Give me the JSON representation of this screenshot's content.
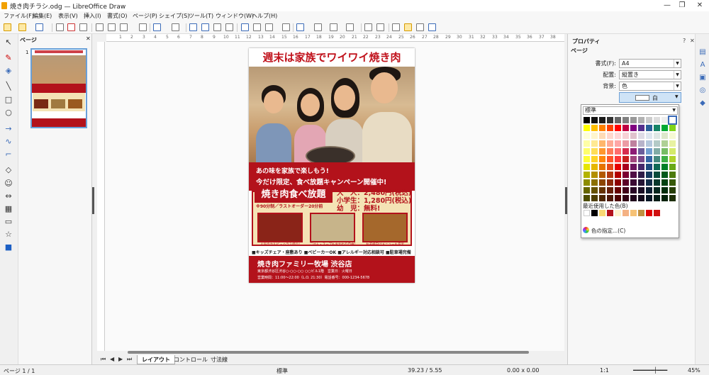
{
  "window": {
    "title": "焼き肉チラシ.odg — LibreOffice Draw",
    "controls": [
      "—",
      "❐",
      "✕"
    ]
  },
  "menu": [
    "ファイル(F)",
    "編集(E)",
    "表示(V)",
    "挿入(I)",
    "書式(O)",
    "ページ(P)",
    "シェイプ(S)",
    "ツール(T)",
    "ウィンドウ(W)",
    "ヘルプ(H)"
  ],
  "pages_panel": {
    "title": "ページ",
    "close": "✕",
    "page_number": "1"
  },
  "ruler_h": [
    "1",
    "2",
    "3",
    "4",
    "5",
    "6",
    "7",
    "8",
    "9",
    "10",
    "11",
    "12",
    "13",
    "14",
    "15",
    "16",
    "17",
    "18",
    "19",
    "20",
    "21",
    "22",
    "23",
    "24",
    "25",
    "26",
    "27",
    "28",
    "29",
    "30",
    "31",
    "32",
    "33",
    "34",
    "35",
    "36",
    "37",
    "38"
  ],
  "flyer": {
    "title": "週末は家族でワイワイ焼き肉",
    "line1": "あの味を家族で楽しもう!",
    "line2": "今だけ限定、食べ放題キャンペーン開催中!",
    "plan": "焼き肉食べ放題",
    "plan_sub": "※90分制／ラストオーダー20分前",
    "prices": [
      "大　人：2,480円(税込)",
      "小学生：1,280円(税込)",
      "幼　児：無料!"
    ],
    "food_captions": [
      "人気のカルビ・ハラミ盛り!",
      "ごはん・スープもおかわり自由!",
      "お子様向けメニューも充実"
    ],
    "features": "■キッズチェア・座敷あり ■ベビーカーOK ■アレルギー対応相談可 ■駐車場完備",
    "store": "焼き肉ファミリー牧場 渋谷店",
    "address": "東京都渋谷区渋谷○-○○-○○ ○○ビル1階　営業日：火曜日",
    "hours": "営業時間：11:00～22:00（L.O. 21:30）電話番号：000-1234-5678"
  },
  "sheet_tabs": [
    "レイアウト",
    "コントロール",
    "寸法線"
  ],
  "sidebar": {
    "title": "プロパティ",
    "controls": [
      "?",
      "✕",
      "≡"
    ],
    "section": "ページ",
    "format_label": "書式(F):",
    "format_value": "A4",
    "orientation_label": "配置:",
    "orientation_value": "縦置き",
    "background_label": "背景:",
    "background_value": "色",
    "color_value": "白"
  },
  "color_popup": {
    "palette": "標準",
    "recent_label": "最近使用した色(B)",
    "custom_label": "色の指定...(C)",
    "recent": [
      "#ffffff",
      "#000000",
      "#f9d975",
      "#b3121b",
      "#fff2cc",
      "#f4b183",
      "#f6c276",
      "#c09040",
      "#e00000",
      "#d01010"
    ]
  },
  "status": {
    "page": "ページ 1 / 1",
    "style": "標準",
    "position": "39.23 / 5.55",
    "size": "0.00 x 0.00",
    "scale": "1:1",
    "zoom": "45%"
  }
}
